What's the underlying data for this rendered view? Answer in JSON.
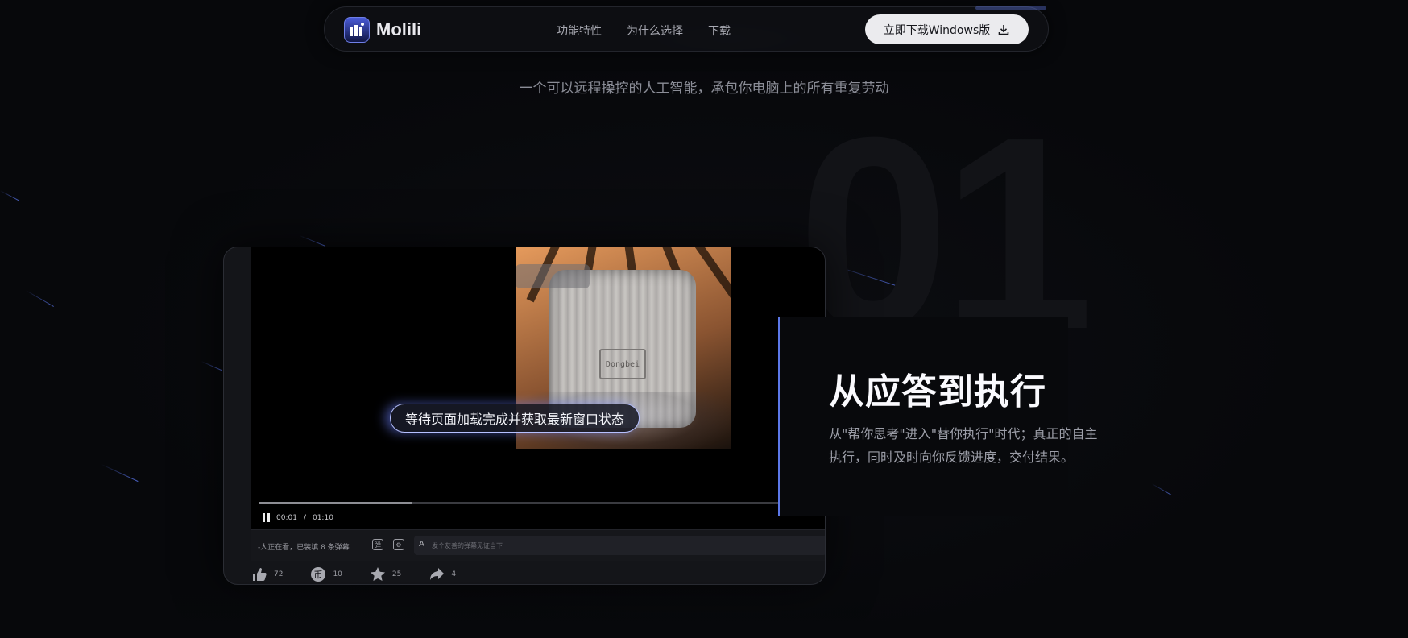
{
  "brand": {
    "name": "Molili",
    "accent": "#5c78e8"
  },
  "nav": {
    "links": [
      "功能特性",
      "为什么选择",
      "下载"
    ],
    "cta_label": "立即下载Windows版",
    "cta_icon": "download-icon"
  },
  "hero": {
    "subtitle": "一个可以远程操控的人工智能，承包你电脑上的所有重复劳动"
  },
  "section": {
    "number": "01",
    "title": "从应答到执行",
    "description": "从\"帮你思考\"进入\"替你执行\"时代；真正的自主执行，同时及时向你反馈进度，交付结果。"
  },
  "video": {
    "caption": "等待页面加载完成并获取最新窗口状态",
    "case_label": "Dongbei",
    "time_current": "00:01",
    "time_separator": "/",
    "time_total": "01:10",
    "progress": 0.29,
    "viewers_text": "-人正在看，已装填 8 条弹幕",
    "danmaku_placeholder": "发个友善的弹幕见证当下",
    "danmaku_toggle_icon": "danmaku-toggle-icon",
    "danmaku_settings_icon": "danmaku-settings-icon"
  },
  "actions": [
    {
      "icon": "like-icon",
      "count": "72"
    },
    {
      "icon": "coin-icon",
      "count": "10"
    },
    {
      "icon": "favorite-icon",
      "count": "25"
    },
    {
      "icon": "share-icon",
      "count": "4"
    }
  ]
}
